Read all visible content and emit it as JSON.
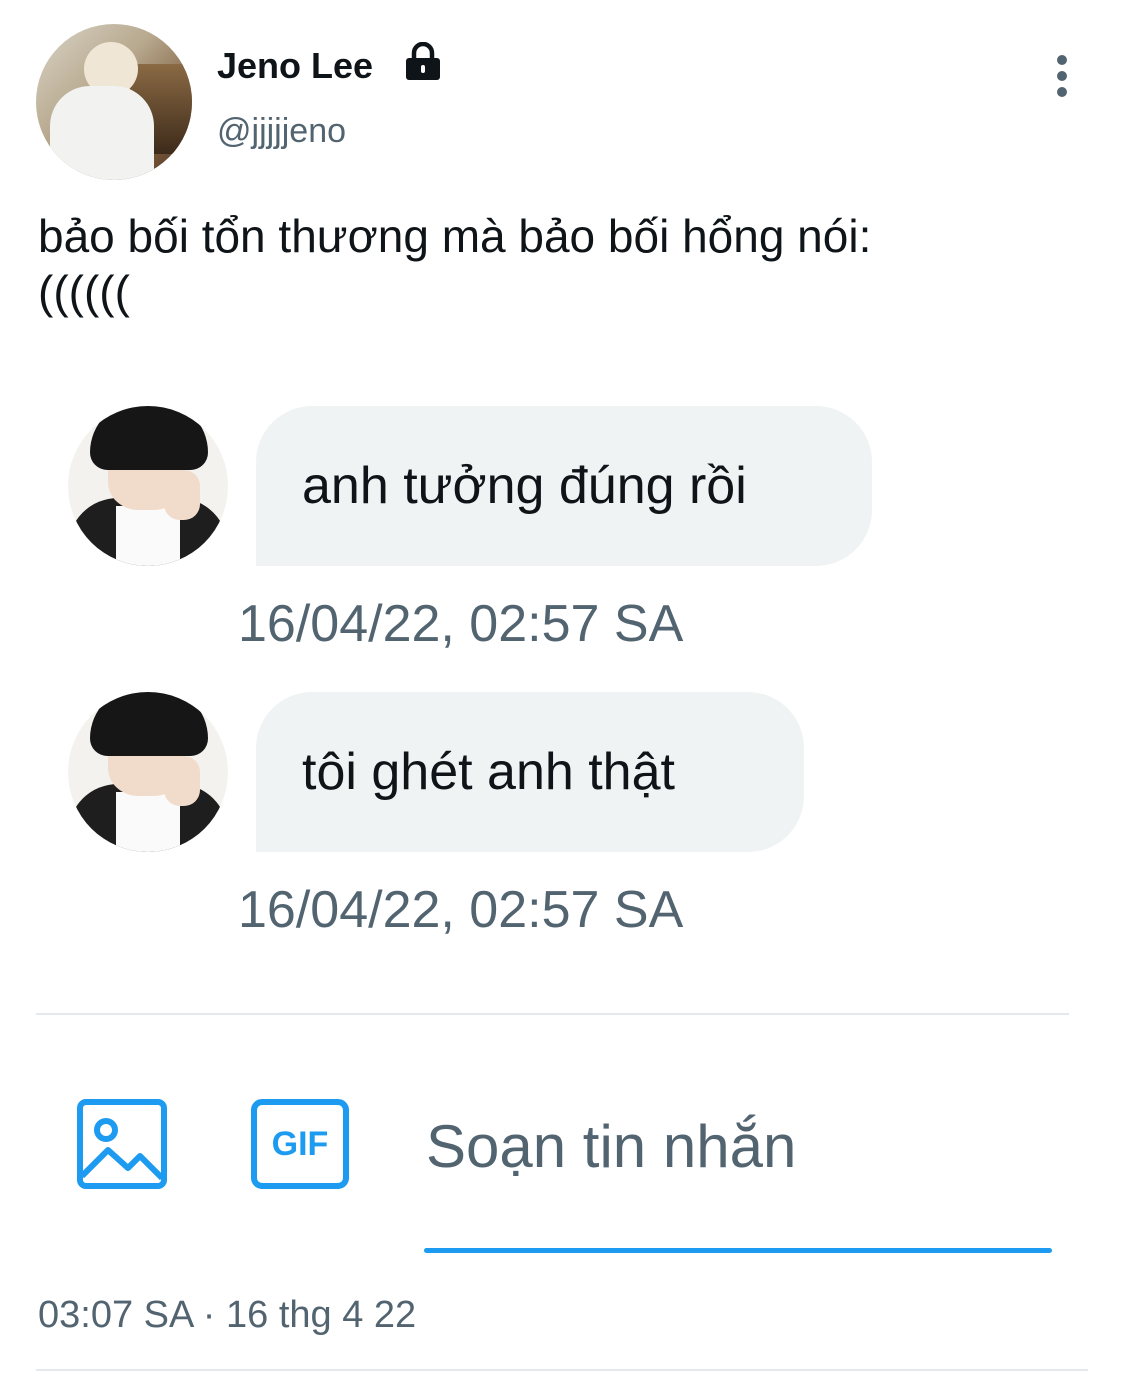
{
  "header": {
    "display_name": "Jeno Lee",
    "handle": "@jjjjjeno",
    "lock_icon": "lock-icon",
    "more_icon": "more-vertical-icon"
  },
  "tweet": {
    "text": "bảo bối tổn thương mà bảo bối hổng nói:\n((((((",
    "messages": [
      {
        "text": "anh tưởng đúng rồi",
        "time": "16/04/22, 02:57 SA"
      },
      {
        "text": "tôi ghét anh thật",
        "time": "16/04/22, 02:57 SA"
      }
    ],
    "compose": {
      "placeholder": "Soạn tin nhắn",
      "gif_label": "GIF",
      "image_icon": "image-icon",
      "accent_color": "#1d9bf0"
    },
    "meta": "03:07 SA · 16 thg 4 22"
  }
}
